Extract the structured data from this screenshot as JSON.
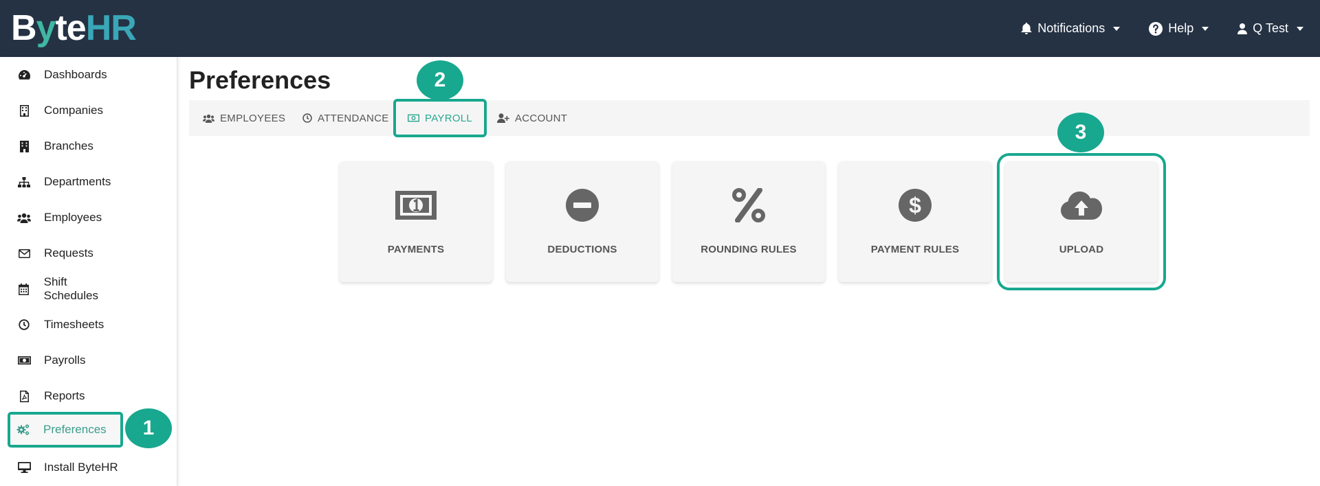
{
  "app": {
    "logo_parts": [
      "B",
      "y",
      "te",
      "HR"
    ]
  },
  "topnav": {
    "notifications": "Notifications",
    "help": "Help",
    "user": "Q Test"
  },
  "sidebar": {
    "items": [
      {
        "label": "Dashboards",
        "icon": "dashboard-icon"
      },
      {
        "label": "Companies",
        "icon": "building-icon"
      },
      {
        "label": "Branches",
        "icon": "branch-icon"
      },
      {
        "label": "Departments",
        "icon": "sitemap-icon"
      },
      {
        "label": "Employees",
        "icon": "users-icon"
      },
      {
        "label": "Requests",
        "icon": "envelope-icon"
      },
      {
        "label": "Shift Schedules",
        "icon": "calendar-icon"
      },
      {
        "label": "Timesheets",
        "icon": "clock-icon"
      },
      {
        "label": "Payrolls",
        "icon": "money-icon"
      },
      {
        "label": "Reports",
        "icon": "pdf-icon"
      },
      {
        "label": "Preferences",
        "icon": "cogs-icon",
        "active": true
      },
      {
        "label": "Install ByteHR",
        "icon": "desktop-icon"
      }
    ]
  },
  "main": {
    "title": "Preferences",
    "tabs": [
      {
        "label": "EMPLOYEES",
        "icon": "users-icon"
      },
      {
        "label": "ATTENDANCE",
        "icon": "clock-icon"
      },
      {
        "label": "PAYROLL",
        "icon": "money-icon",
        "active": true
      },
      {
        "label": "ACCOUNT",
        "icon": "user-plus-icon"
      }
    ],
    "cards": [
      {
        "label": "PAYMENTS",
        "icon": "money-bill-icon"
      },
      {
        "label": "DEDUCTIONS",
        "icon": "minus-circle-icon"
      },
      {
        "label": "ROUNDING RULES",
        "icon": "percent-icon"
      },
      {
        "label": "PAYMENT RULES",
        "icon": "dollar-circle-icon"
      },
      {
        "label": "UPLOAD",
        "icon": "cloud-upload-icon"
      }
    ]
  },
  "steps": [
    "1",
    "2",
    "3"
  ],
  "colors": {
    "topbar": "#253244",
    "accent": "#18a88f",
    "accent_text": "#29a891"
  }
}
